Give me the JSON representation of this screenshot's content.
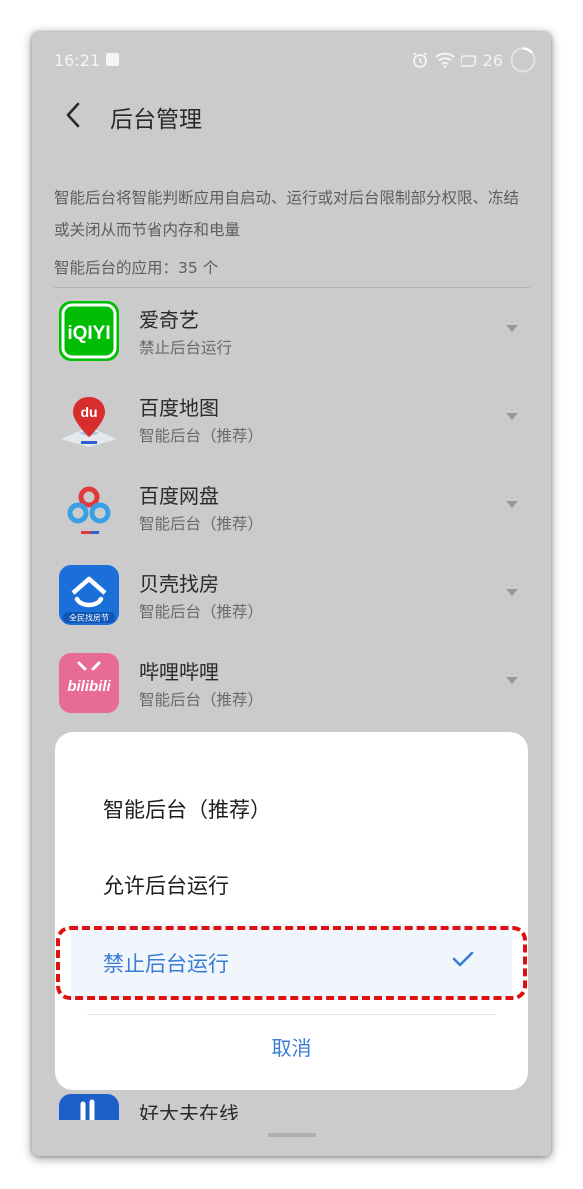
{
  "status_bar": {
    "time": "16:21",
    "battery": "26"
  },
  "header": {
    "title": "后台管理"
  },
  "description": "智能后台将智能判断应用自启动、运行或对后台限制部分权限、冻结或关闭从而节省内存和电量",
  "app_count": "智能后台的应用：35 个",
  "apps": [
    {
      "name": "爱奇艺",
      "status": "禁止后台运行",
      "icon": "iqiyi-icon"
    },
    {
      "name": "百度地图",
      "status": "智能后台（推荐）",
      "icon": "baidu-map-icon"
    },
    {
      "name": "百度网盘",
      "status": "智能后台（推荐）",
      "icon": "baidu-netdisk-icon"
    },
    {
      "name": "贝壳找房",
      "status": "智能后台（推荐）",
      "icon": "beike-icon"
    },
    {
      "name": "哔哩哔哩",
      "status": "智能后台（推荐）",
      "icon": "bilibili-icon"
    },
    {
      "name": "好大夫在线",
      "status": "",
      "icon": "haodf-icon"
    }
  ],
  "sheet": {
    "options": [
      "智能后台（推荐）",
      "允许后台运行",
      "禁止后台运行"
    ],
    "selected_index": 2,
    "cancel": "取消"
  },
  "icon_texts": {
    "iqiyi": "iQIYI",
    "baidu_map": "du",
    "beike_caption": "全民找房节",
    "bilibili": "bilibili"
  },
  "colors": {
    "accent": "#3a7cd6",
    "highlight": "#e01010",
    "iqiyi_green": "#00be06",
    "bilibili_pink": "#e76b95",
    "beike_blue": "#1b6fd8"
  }
}
